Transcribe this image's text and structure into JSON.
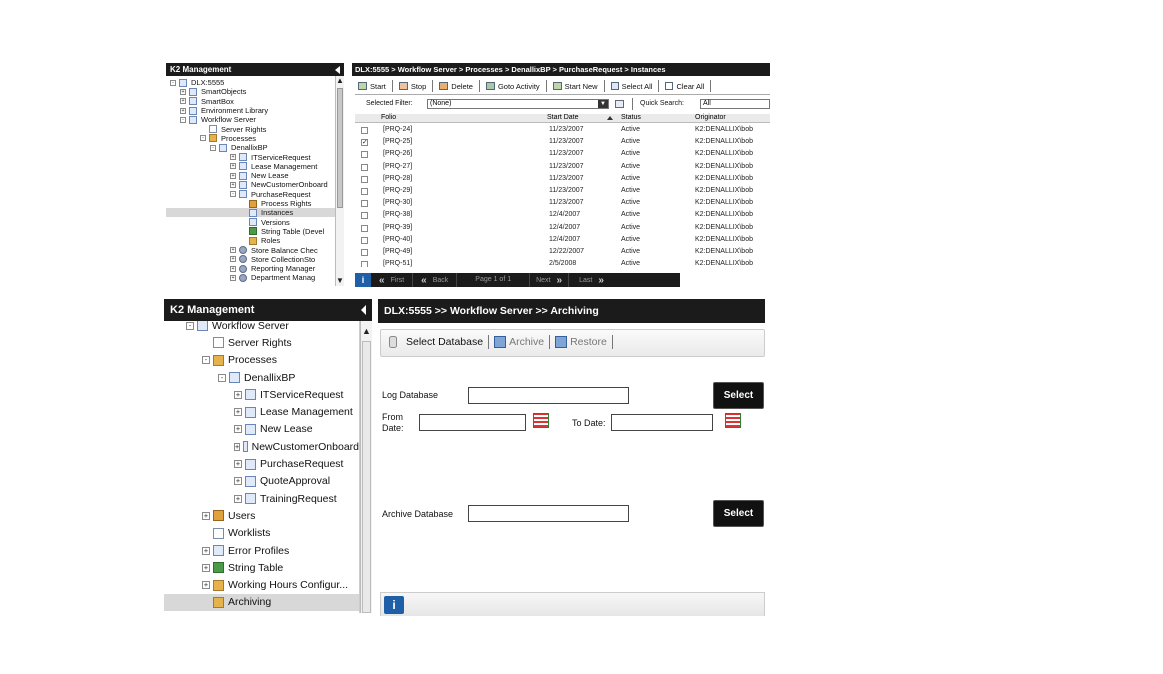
{
  "top": {
    "sidebar": {
      "title": "K2 Management",
      "items": [
        {
          "label": "DLX:5555",
          "icon": "server-icon"
        },
        {
          "label": "SmartObjects",
          "icon": "smartobjects-icon"
        },
        {
          "label": "SmartBox",
          "icon": "smartbox-icon"
        },
        {
          "label": "Environment Library",
          "icon": "library-icon"
        },
        {
          "label": "Workflow Server",
          "icon": "workflow-server-icon"
        },
        {
          "label": "Server Rights",
          "icon": "rights-icon"
        },
        {
          "label": "Processes",
          "icon": "processes-icon"
        },
        {
          "label": "DenallixBP",
          "icon": "project-icon"
        },
        {
          "label": "ITServiceRequest",
          "icon": "process-icon"
        },
        {
          "label": "Lease Management",
          "icon": "process-icon"
        },
        {
          "label": "New Lease",
          "icon": "process-icon"
        },
        {
          "label": "NewCustomerOnboard",
          "icon": "process-icon"
        },
        {
          "label": "PurchaseRequest",
          "icon": "process-icon"
        },
        {
          "label": "Process Rights",
          "icon": "rights-icon"
        },
        {
          "label": "Instances",
          "icon": "instances-icon"
        },
        {
          "label": "Versions",
          "icon": "versions-icon"
        },
        {
          "label": "String Table (Devel",
          "icon": "string-table-icon"
        },
        {
          "label": "Roles",
          "icon": "roles-icon"
        },
        {
          "label": "Store Balance Chec",
          "icon": "process-icon"
        },
        {
          "label": "Store CollectionSto",
          "icon": "process-icon"
        },
        {
          "label": "Reporting Manager",
          "icon": "process-icon"
        },
        {
          "label": "Department Manag",
          "icon": "process-icon"
        }
      ]
    },
    "breadcrumb": "DLX:5555 > Workflow Server > Processes > DenallixBP > PurchaseRequest > Instances",
    "toolbar": {
      "start": "Start",
      "stop": "Stop",
      "delete": "Delete",
      "goto_activity": "Goto Activity",
      "start_new": "Start New",
      "select_all": "Select All",
      "clear_all": "Clear All"
    },
    "filter": {
      "label": "Selected Filter:",
      "value": "(None)",
      "search_label": "Quick Search:",
      "search_value": "All"
    },
    "columns": {
      "folio": "Folio",
      "start_date": "Start Date",
      "status": "Status",
      "originator": "Originator"
    },
    "rows": [
      {
        "folio": "[PRQ-24]",
        "date": "11/23/2007",
        "status": "Active",
        "originator": "K2:DENALLIX\\bob",
        "checked": false
      },
      {
        "folio": "[PRQ-25]",
        "date": "11/23/2007",
        "status": "Active",
        "originator": "K2:DENALLIX\\bob",
        "checked": true
      },
      {
        "folio": "[PRQ-26]",
        "date": "11/23/2007",
        "status": "Active",
        "originator": "K2:DENALLIX\\bob",
        "checked": false
      },
      {
        "folio": "[PRQ-27]",
        "date": "11/23/2007",
        "status": "Active",
        "originator": "K2:DENALLIX\\bob",
        "checked": false
      },
      {
        "folio": "[PRQ-28]",
        "date": "11/23/2007",
        "status": "Active",
        "originator": "K2:DENALLIX\\bob",
        "checked": false
      },
      {
        "folio": "[PRQ-29]",
        "date": "11/23/2007",
        "status": "Active",
        "originator": "K2:DENALLIX\\bob",
        "checked": false
      },
      {
        "folio": "[PRQ-30]",
        "date": "11/23/2007",
        "status": "Active",
        "originator": "K2:DENALLIX\\bob",
        "checked": false
      },
      {
        "folio": "[PRQ-38]",
        "date": "12/4/2007",
        "status": "Active",
        "originator": "K2:DENALLIX\\bob",
        "checked": false
      },
      {
        "folio": "[PRQ-39]",
        "date": "12/4/2007",
        "status": "Active",
        "originator": "K2:DENALLIX\\bob",
        "checked": false
      },
      {
        "folio": "[PRQ-40]",
        "date": "12/4/2007",
        "status": "Active",
        "originator": "K2:DENALLIX\\bob",
        "checked": false
      },
      {
        "folio": "[PRQ-49]",
        "date": "12/22/2007",
        "status": "Active",
        "originator": "K2:DENALLIX\\bob",
        "checked": false
      },
      {
        "folio": "[PRQ-51]",
        "date": "2/5/2008",
        "status": "Active",
        "originator": "K2:DENALLIX\\bob",
        "checked": false
      }
    ],
    "pager": {
      "first": "First",
      "back": "Back",
      "page": "Page 1 of 1",
      "next": "Next",
      "last": "Last"
    }
  },
  "bottom": {
    "sidebar": {
      "title": "K2 Management",
      "items": [
        {
          "label": "Workflow Server",
          "icon": "workflow-server-icon"
        },
        {
          "label": "Server Rights",
          "icon": "rights-icon"
        },
        {
          "label": "Processes",
          "icon": "processes-icon"
        },
        {
          "label": "DenallixBP",
          "icon": "project-icon"
        },
        {
          "label": "ITServiceRequest",
          "icon": "process-icon"
        },
        {
          "label": "Lease Management",
          "icon": "process-icon"
        },
        {
          "label": "New Lease",
          "icon": "process-icon"
        },
        {
          "label": "NewCustomerOnboard",
          "icon": "process-icon"
        },
        {
          "label": "PurchaseRequest",
          "icon": "process-icon"
        },
        {
          "label": "QuoteApproval",
          "icon": "process-icon"
        },
        {
          "label": "TrainingRequest",
          "icon": "process-icon"
        },
        {
          "label": "Users",
          "icon": "users-icon"
        },
        {
          "label": "Worklists",
          "icon": "worklists-icon"
        },
        {
          "label": "Error Profiles",
          "icon": "error-profiles-icon"
        },
        {
          "label": "String Table",
          "icon": "string-table-icon"
        },
        {
          "label": "Working Hours Configur...",
          "icon": "working-hours-icon"
        },
        {
          "label": "Archiving",
          "icon": "archiving-icon"
        }
      ]
    },
    "breadcrumb": "DLX:5555 >> Workflow Server >> Archiving",
    "toolbar": {
      "select_database": "Select Database",
      "archive": "Archive",
      "restore": "Restore"
    },
    "form": {
      "log_database_label": "Log Database",
      "from_date_label": "From Date:",
      "to_date_label": "To Date:",
      "archive_database_label": "Archive Database",
      "select_button": "Select",
      "select_button_2": "Select",
      "log_database_value": "",
      "from_date_value": "",
      "to_date_value": "",
      "archive_database_value": ""
    }
  }
}
